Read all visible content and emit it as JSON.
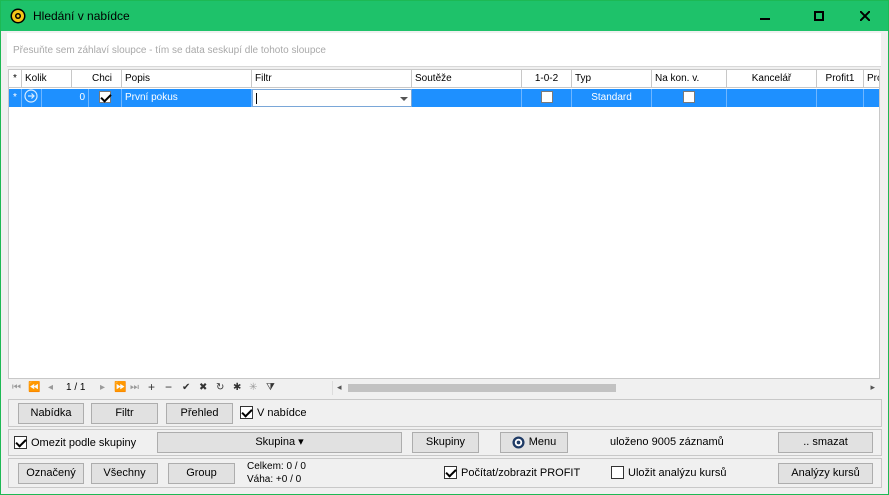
{
  "window": {
    "title": "Hledání v nabídce",
    "accent": "#1ec26a",
    "minimize_icon": "minimize-icon",
    "maximize_icon": "maximize-icon",
    "close_icon": "close-icon"
  },
  "group_panel": {
    "hint": "Přesuňte sem záhlaví sloupce - tím se data seskupí dle tohoto sloupce"
  },
  "grid": {
    "columns": [
      "Kolik",
      "Chci",
      "Popis",
      "Filtr",
      "Soutěže",
      "1-0-2",
      "Typ",
      "Na kon. v.",
      "Kancelář",
      "Profit1",
      "Pro"
    ],
    "new_row_marker": "*",
    "row": {
      "kolik": "0",
      "chci": true,
      "popis": "První pokus",
      "filtr": "",
      "soutezhe": "",
      "one_o_two": false,
      "typ": "Standard",
      "na_kon_v": false,
      "kancelar": "",
      "profit1": ""
    },
    "selected_color": "#1e90ff"
  },
  "navigator": {
    "page": "1 / 1"
  },
  "panel1": {
    "nabidka": "Nabídka",
    "filtr": "Filtr",
    "prehled": "Přehled",
    "v_nabidce": "V nabídce",
    "v_nabidce_checked": true
  },
  "panel2": {
    "omezit": "Omezit podle skupiny",
    "omezit_checked": true,
    "skupina": "Skupina ▾",
    "skupiny": "Skupiny",
    "menu": "Menu",
    "ulozeno": "uloženo 9005 záznamů",
    "smazat": ".. smazat"
  },
  "panel3": {
    "oznaceny": "Označený",
    "vsechny": "Všechny",
    "group": "Group",
    "celkem": "Celkem: 0 / 0",
    "vaha": "Váha: +0 / 0",
    "pocitat": "Počítat/zobrazit PROFIT",
    "pocitat_checked": true,
    "ulozit": "Uložit analýzu kursů",
    "ulozit_checked": false,
    "analyzy": "Analýzy kursů"
  }
}
